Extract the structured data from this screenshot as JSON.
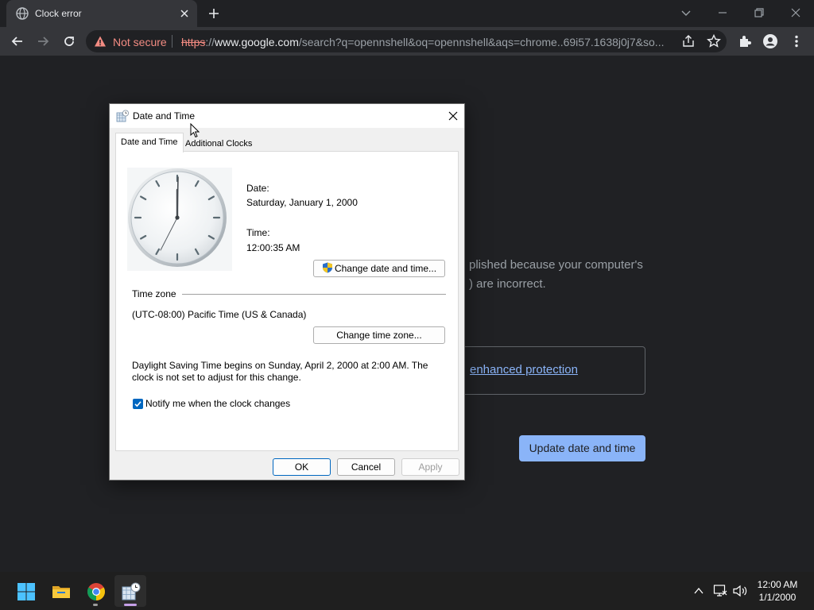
{
  "browser": {
    "tab_title": "Clock error",
    "security_label": "Not secure",
    "url_scheme": "https",
    "url_sep": "://",
    "url_host": "www.google.com",
    "url_rest": "/search?q=opennshell&oq=opennshell&aqs=chrome..69i57.1638j0j7&so..."
  },
  "page": {
    "message": "plished because your computer's\n) are incorrect.",
    "protection_link": "enhanced protection",
    "update_button": "Update date and time"
  },
  "dialog": {
    "title": "Date and Time",
    "tabs": [
      {
        "label": "Date and Time",
        "selected": true
      },
      {
        "label": "Additional Clocks",
        "selected": false
      }
    ],
    "date_label": "Date:",
    "date_value": "Saturday, January 1, 2000",
    "time_label": "Time:",
    "time_value": "12:00:35 AM",
    "change_datetime_button": "Change date and time...",
    "timezone_heading": "Time zone",
    "timezone_value": "(UTC-08:00) Pacific Time (US & Canada)",
    "change_timezone_button": "Change time zone...",
    "dst_notice": "Daylight Saving Time begins on Sunday, April 2, 2000 at 2:00 AM. The clock is not set to adjust for this change.",
    "notify_checkbox_label": "Notify me when the clock changes",
    "notify_checked": true,
    "ok_button": "OK",
    "cancel_button": "Cancel",
    "apply_button": "Apply",
    "apply_enabled": false
  },
  "taskbar": {
    "apps": [
      "start-icon",
      "file-explorer-icon",
      "chrome-icon",
      "date-time-icon"
    ],
    "clock_time": "12:00 AM",
    "clock_date": "1/1/2000"
  },
  "colors": {
    "accent": "#0067c0",
    "chrome_link": "#8ab4f8",
    "not_secure": "#f28b82"
  }
}
